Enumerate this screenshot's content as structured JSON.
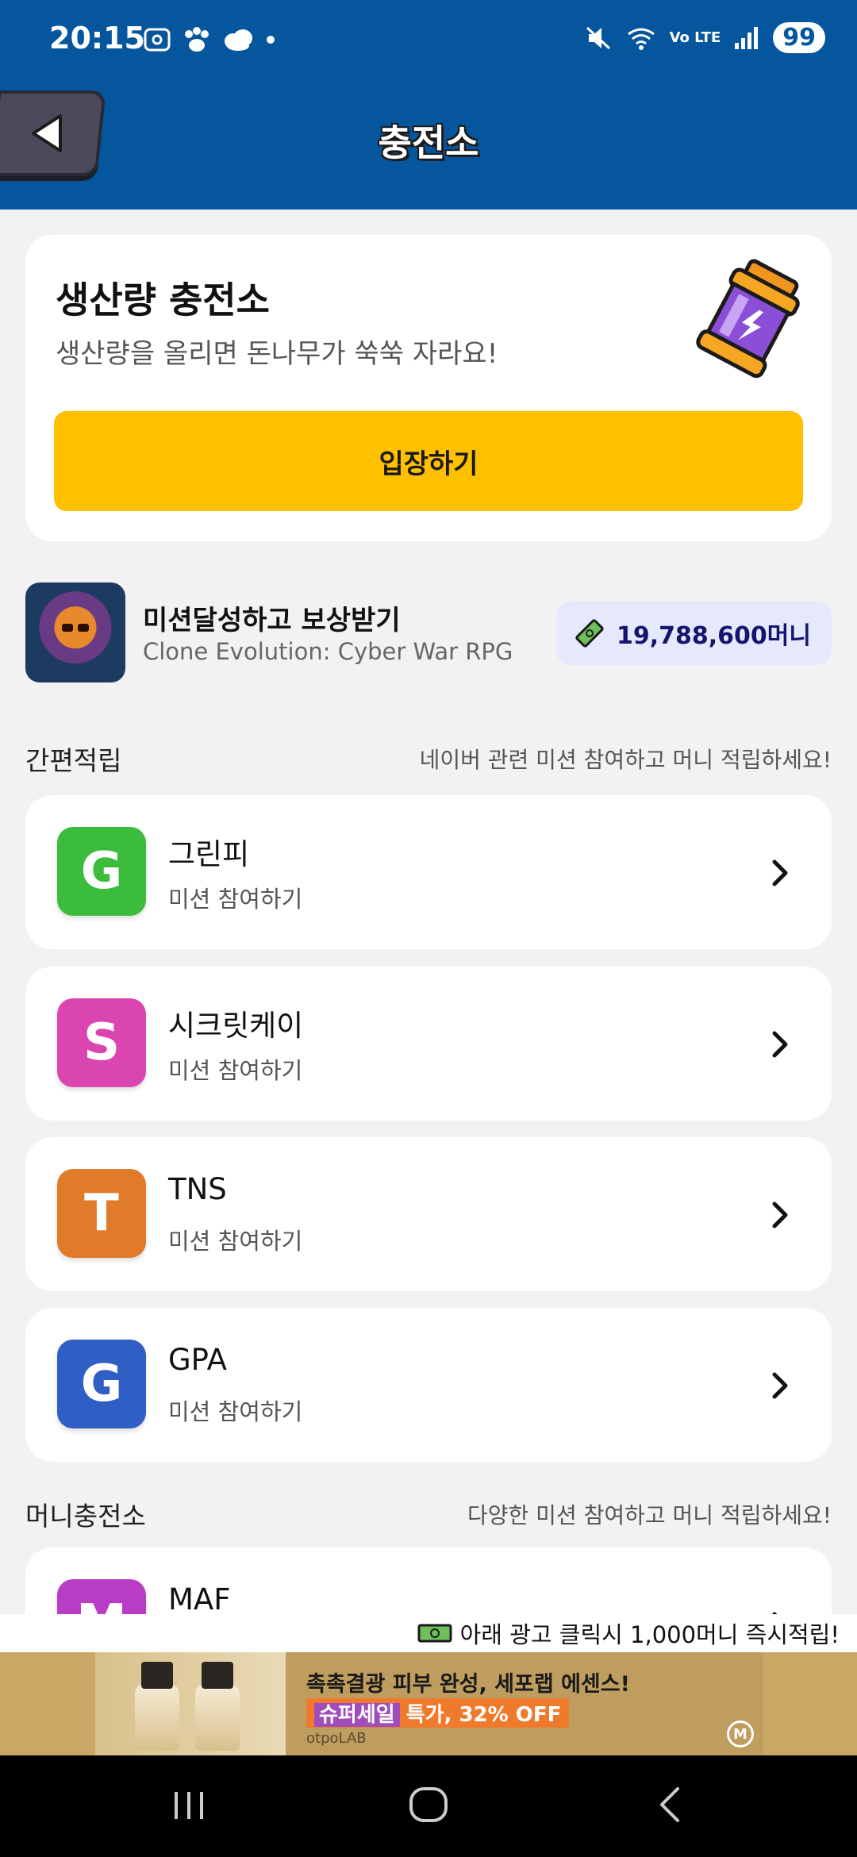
{
  "status_bar": {
    "time": "20:15",
    "battery": "99",
    "network_label": "Vo LTE",
    "left_icons": [
      "screenshot-icon",
      "paw-icon",
      "cloud-icon",
      "dot-icon"
    ],
    "right_icons": [
      "mute-icon",
      "wifi-icon",
      "lte-icon",
      "signal-icon"
    ]
  },
  "header": {
    "title": "충전소"
  },
  "charge_card": {
    "title": "생산량 충전소",
    "description": "생산량을 올리면 돈나무가 쑥쑥 자라요!",
    "button_label": "입장하기"
  },
  "mission": {
    "title": "미션달성하고 보상받기",
    "subtitle": "Clone Evolution: Cyber War RPG",
    "reward": "19,788,600머니"
  },
  "quick_section": {
    "title": "간편적립",
    "subtitle": "네이버 관련 미션 참여하고 머니 적립하세요!",
    "items": [
      {
        "letter": "G",
        "name": "그린피",
        "sub": "미션 참여하기",
        "color": "#3cbc3c"
      },
      {
        "letter": "S",
        "name": "시크릿케이",
        "sub": "미션 참여하기",
        "color": "#db45b0"
      },
      {
        "letter": "T",
        "name": "TNS",
        "sub": "미션 참여하기",
        "color": "#e07b2a"
      },
      {
        "letter": "G",
        "name": "GPA",
        "sub": "미션 참여하기",
        "color": "#2f5fc4"
      }
    ]
  },
  "money_section": {
    "title": "머니충전소",
    "subtitle": "다양한 미션 참여하고 머니 적립하세요!",
    "items": [
      {
        "letter": "M",
        "name": "MAF",
        "color": "#b83cc4"
      }
    ]
  },
  "ad": {
    "note": "아래 광고 클릭시 1,000머니 즉시적립!",
    "headline": "촉촉결광 피부 완성, 세포랩 에센스!",
    "badge": "슈퍼세일",
    "offer": "특가, 32% OFF",
    "brand": "otpoLAB",
    "mark": "M"
  },
  "colors": {
    "header_bg": "#05569d",
    "accent_button": "#ffc000",
    "reward_bg": "#e6e9fb",
    "page_bg": "#f2f2f2"
  }
}
